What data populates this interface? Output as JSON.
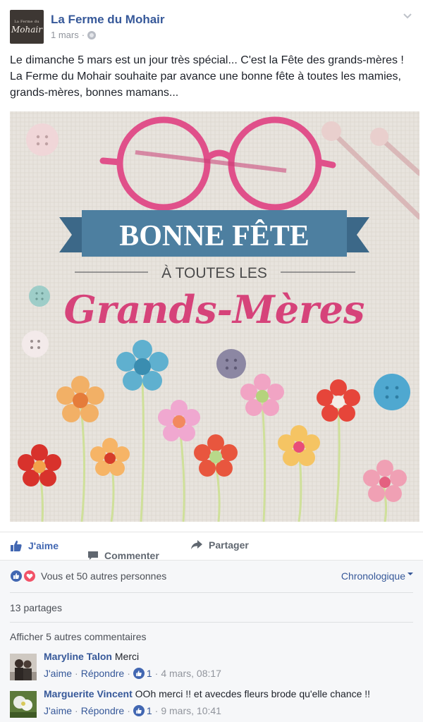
{
  "post": {
    "page_name": "La Ferme du Mohair",
    "avatar_small_text": "La Ferme du",
    "avatar_logo_text": "Mohair",
    "date": "1 mars",
    "separator": "·",
    "text": "Le dimanche 5 mars est un jour très spécial... C'est la Fête des grands-mères ! La Ferme du Mohair souhaite par avance une bonne fête à toutes les mamies, grands-mères, bonnes mamans...",
    "image": {
      "line1": "BONNE FÊTE",
      "line2": "À TOUTES LES",
      "line3": "Grands-Mères"
    }
  },
  "actions": {
    "like": "J'aime",
    "comment": "Commenter",
    "share": "Partager"
  },
  "feedback": {
    "reactions_text": "Vous et 50 autres personnes",
    "sort_label": "Chronologique",
    "shares_text": "13 partages",
    "more_comments": "Afficher 5 autres commentaires"
  },
  "comments": [
    {
      "author": "Maryline Talon",
      "text": "Merci",
      "like_label": "J'aime",
      "reply_label": "Répondre",
      "likes": "1",
      "time": "4 mars, 08:17"
    },
    {
      "author": "Marguerite Vincent",
      "text": "OOh merci !! et avecdes fleurs brode qu'elle chance !!",
      "like_label": "J'aime",
      "reply_label": "Répondre",
      "likes": "1",
      "time": "9 mars, 10:41"
    }
  ],
  "colors": {
    "link": "#365899",
    "like_active": "#4267b2",
    "love": "#f25268",
    "glasses": "#e0508a",
    "banner": "#4d7fa0",
    "title_script": "#d6437a"
  },
  "icons": [
    "globe-icon",
    "chevron-down-icon",
    "thumbs-up-icon",
    "comment-bubble-icon",
    "share-arrow-icon",
    "heart-icon"
  ]
}
